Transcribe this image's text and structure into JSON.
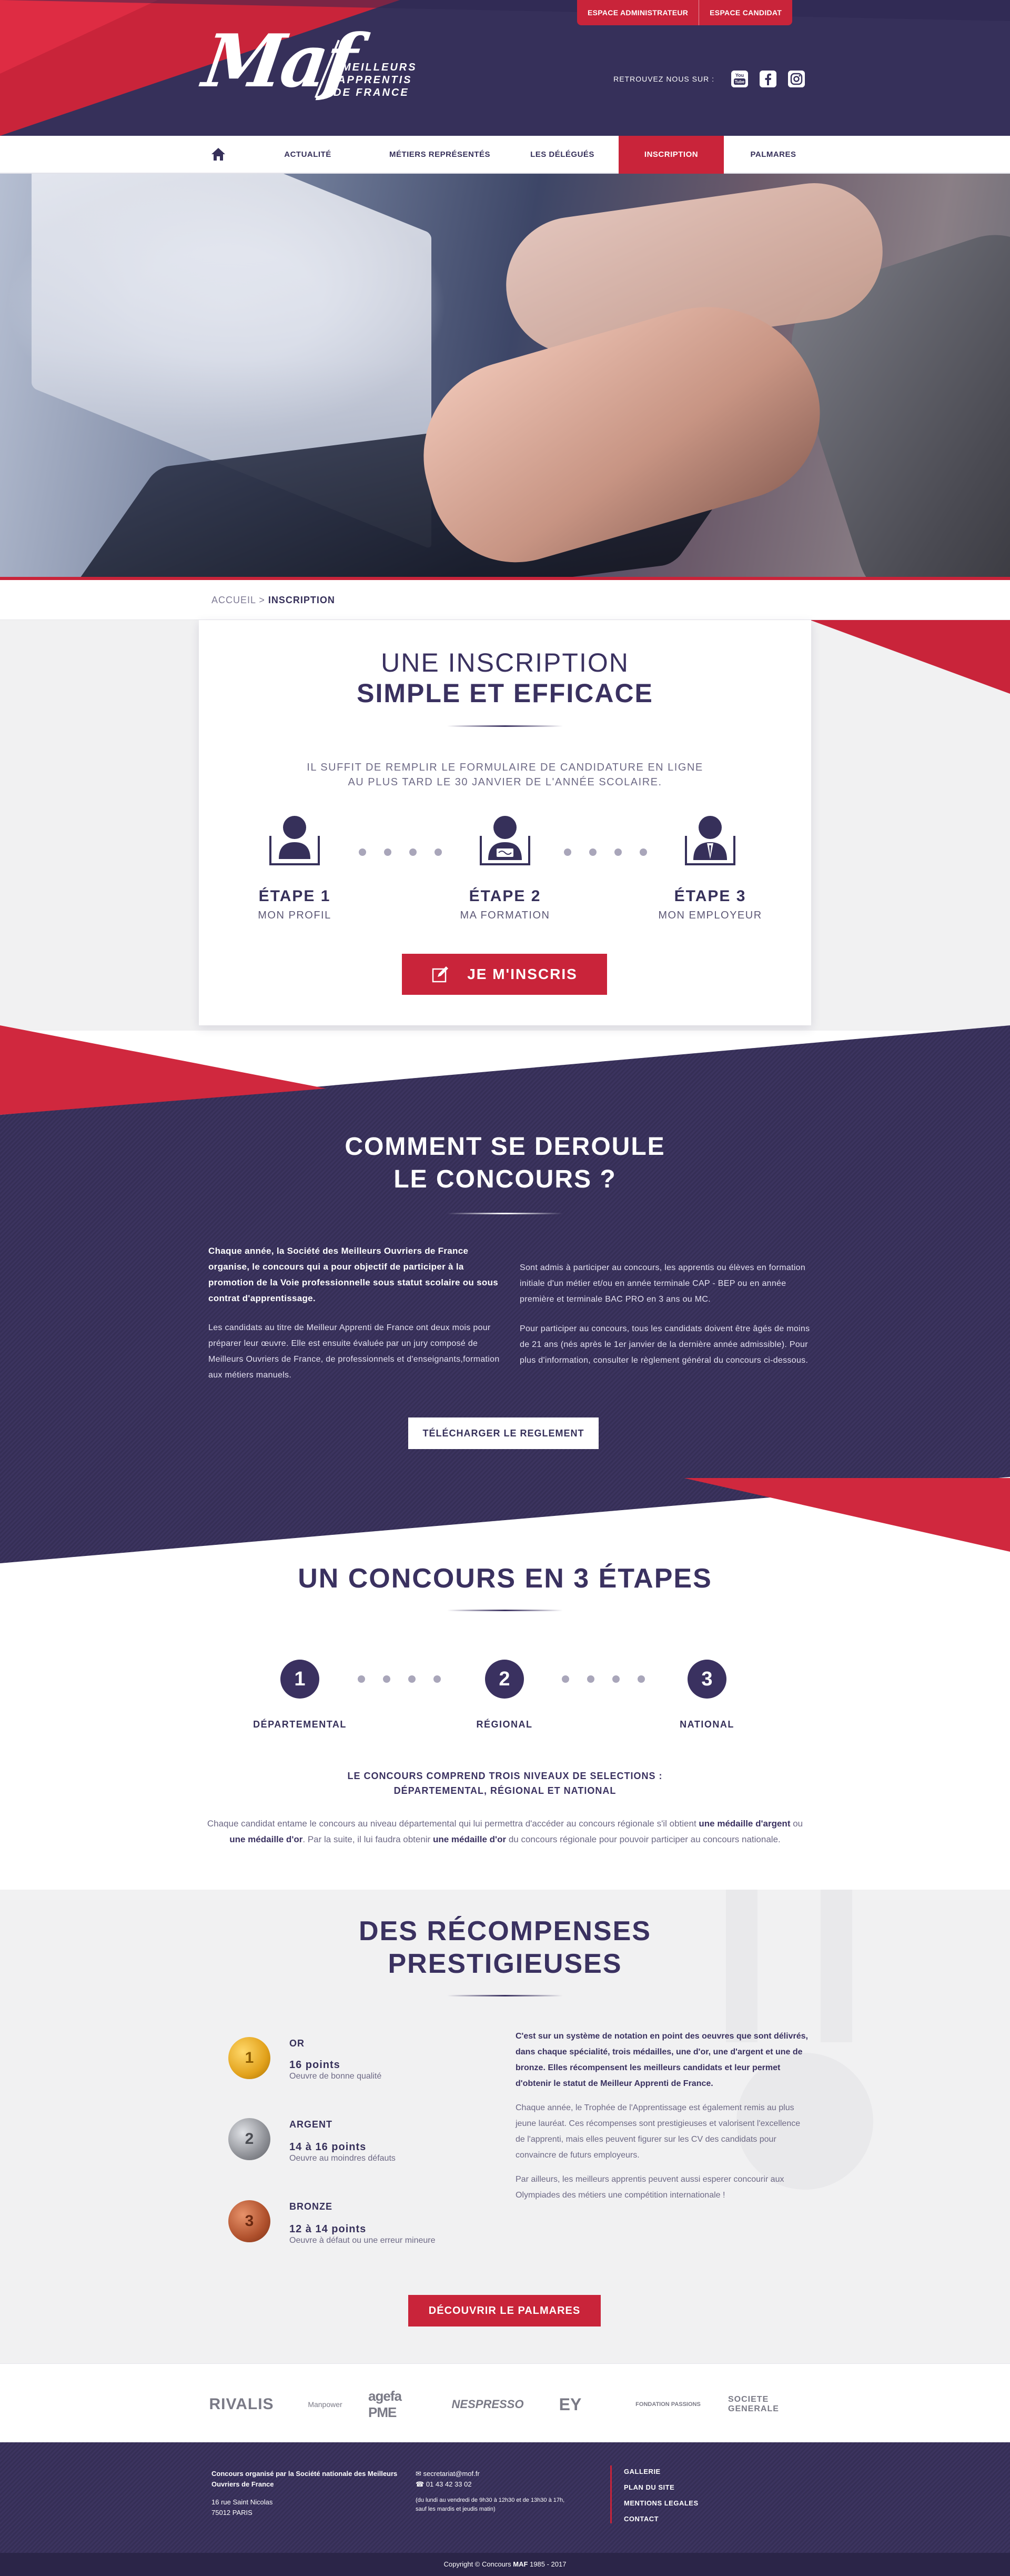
{
  "header": {
    "logo_text": "Maf",
    "logo_lines": [
      "MEILLEURS",
      "APPRENTIS",
      "DE FRANCE"
    ],
    "top_buttons": [
      "ESPACE ADMINISTRATEUR",
      "ESPACE CANDIDAT"
    ],
    "social_label": "RETROUVEZ NOUS SUR :",
    "social_icons": [
      "youtube-icon",
      "facebook-icon",
      "instagram-icon"
    ]
  },
  "nav": {
    "items": [
      "ACTUALITÉ",
      "MÉTIERS REPRÉSENTÉS",
      "LES DÉLÉGUÉS",
      "INSCRIPTION",
      "PALMARES"
    ],
    "active": "INSCRIPTION"
  },
  "breadcrumb": {
    "home": "ACCUEIL",
    "sep": ">",
    "current": "INSCRIPTION"
  },
  "inscription": {
    "title_light": "UNE INSCRIPTION",
    "title_bold": "SIMPLE ET EFFICACE",
    "intro_1": "IL SUFFIT DE REMPLIR LE FORMULAIRE DE CANDIDATURE EN LIGNE",
    "intro_2": "AU PLUS TARD LE 30 JANVIER DE L'ANNÉE SCOLAIRE.",
    "steps": [
      {
        "title": "ÉTAPE 1",
        "sub": "MON PROFIL"
      },
      {
        "title": "ÉTAPE 2",
        "sub": "MA FORMATION"
      },
      {
        "title": "ÉTAPE 3",
        "sub": "MON EMPLOYEUR"
      }
    ],
    "button": "JE M'INSCRIS"
  },
  "deroulement": {
    "title_1": "COMMENT SE DEROULE",
    "title_2": "LE CONCOURS ?",
    "left_bold": "Chaque année, la Société des Meilleurs Ouvriers de France organise, le concours qui a pour objectif de participer à la promotion de la Voie professionnelle sous statut scolaire ou sous contrat d'apprentissage.",
    "left_p": "Les candidats au titre de Meilleur Apprenti de France ont deux mois pour préparer leur œuvre. Elle est ensuite évaluée par un jury composé de Meilleurs Ouvriers de France, de professionnels et d'enseignants,formation aux métiers manuels.",
    "right_p1": "Sont admis à participer au concours, les apprentis ou élèves en formation initiale d'un métier et/ou en année terminale CAP - BEP ou en année première et terminale BAC PRO en 3 ans ou MC.",
    "right_p2": "Pour participer au concours, tous les candidats doivent être âgés de moins de 21 ans (nés après le 1er janvier de la dernière année admissible). Pour plus d'information, consulter le règlement général du concours ci-dessous.",
    "button": "TÉLÉCHARGER LE REGLEMENT"
  },
  "etapes": {
    "title": "UN CONCOURS EN 3 ÉTAPES",
    "levels": [
      {
        "num": "1",
        "label": "DÉPARTEMENTAL"
      },
      {
        "num": "2",
        "label": "RÉGIONAL"
      },
      {
        "num": "3",
        "label": "NATIONAL"
      }
    ],
    "lead_1": "LE CONCOURS COMPREND TROIS NIVEAUX DE SELECTIONS :",
    "lead_2": "DÉPARTEMENTAL, RÉGIONAL ET NATIONAL",
    "body_a": "Chaque candidat entame le concours au niveau départemental qui lui permettra d'accéder au concours régionale s'il obtient ",
    "body_b": "une médaille d'argent",
    "body_c": " ou ",
    "body_d": "une médaille d'or",
    "body_e": ". Par la suite, il lui faudra obtenir ",
    "body_f": "une médaille d'or",
    "body_g": " du concours régionale pour pouvoir participer au concours nationale."
  },
  "recompenses": {
    "title_1": "DES RÉCOMPENSES",
    "title_2": "PRESTIGIEUSES",
    "medals": [
      {
        "name": "OR",
        "points": "16 points",
        "desc": "Oeuvre de bonne qualité",
        "color": "#e2a21c",
        "num": "1"
      },
      {
        "name": "ARGENT",
        "points": "14 à 16 points",
        "desc": "Oeuvre au moindres défauts",
        "color": "#8e9096",
        "num": "2"
      },
      {
        "name": "BRONZE",
        "points": "12 à 14 points",
        "desc": "Oeuvre à défaut ou une erreur mineure",
        "color": "#b0512d",
        "num": "3"
      }
    ],
    "right_bold": "C'est sur un système de notation en point des oeuvres que sont délivrés, dans chaque spécialité, trois médailles, une d'or, une d'argent et une de bronze. Elles récompensent les meilleurs candidats et leur permet d'obtenir le statut de Meilleur Apprenti de France.",
    "right_p1": "Chaque année, le Trophée de l'Apprentissage est également remis au plus jeune lauréat. Ces récompenses sont prestigieuses et valorisent l'excellence de l'apprenti, mais elles peuvent figurer sur les CV des candidats pour convaincre de futurs employeurs.",
    "right_p2": "Par ailleurs, les meilleurs apprentis peuvent aussi esperer concourir aux Olympiades des métiers une compétition internationale !",
    "button": "DÉCOUVRIR LE PALMARES"
  },
  "partners": [
    "RIVALIS",
    "Manpower",
    "agefa PME",
    "NESPRESSO",
    "EY",
    "FONDATION PASSIONS",
    "SOCIETE GENERALE"
  ],
  "footer": {
    "org_1": "Concours organisé par la Société nationale des Meilleurs",
    "org_2": "Ouvriers de France",
    "addr_1": "16 rue Saint Nicolas",
    "addr_2": "75012 PARIS",
    "email": "secretariat@mof.fr",
    "phone": "01 43 42 33 02",
    "hours_1": "(du lundi au vendredi de 9h30 à 12h30 et de 13h30 à 17h,",
    "hours_2": "sauf les mardis et jeudis matin)",
    "links": [
      "GALLERIE",
      "PLAN DU SITE",
      "MENTIONS LEGALES",
      "CONTACT"
    ],
    "copyright_a": "Copyright © Concours ",
    "copyright_b": "MAF",
    "copyright_c": " 1985 - 2017"
  },
  "colors": {
    "primary": "#36305a",
    "accent": "#c9243a",
    "light_bg": "#f1f1f2"
  }
}
